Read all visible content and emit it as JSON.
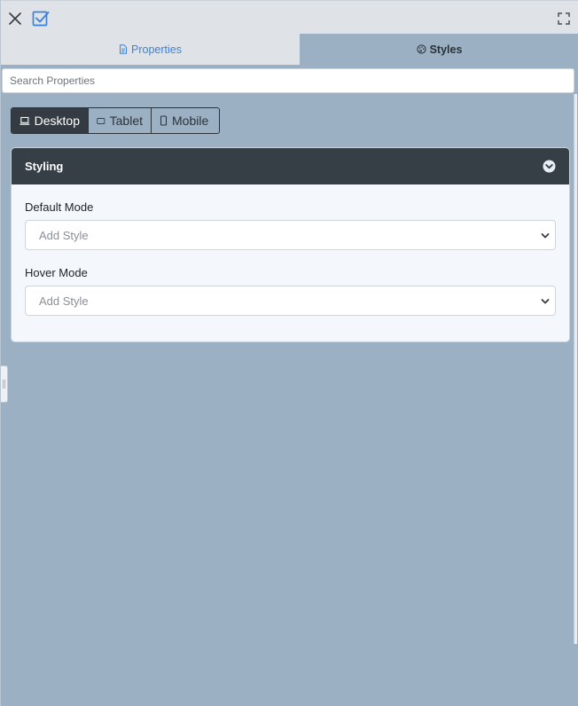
{
  "toolbar": {
    "close_icon": "close-icon",
    "confirm_icon": "checkbox-check-icon",
    "fullscreen_icon": "fullscreen-icon"
  },
  "tabs": [
    {
      "label": "Properties",
      "icon": "document-icon",
      "active": false
    },
    {
      "label": "Styles",
      "icon": "palette-icon",
      "active": true
    }
  ],
  "search": {
    "placeholder": "Search Properties",
    "value": ""
  },
  "devices": [
    {
      "label": "Desktop",
      "icon": "laptop-icon",
      "active": true
    },
    {
      "label": "Tablet",
      "icon": "tablet-icon",
      "active": false
    },
    {
      "label": "Mobile",
      "icon": "mobile-icon",
      "active": false
    }
  ],
  "styling": {
    "title": "Styling",
    "fields": [
      {
        "label": "Default Mode",
        "value": "Add Style"
      },
      {
        "label": "Hover Mode",
        "value": "Add Style"
      }
    ]
  },
  "colors": {
    "panel_bg": "#9bb0c2",
    "toolbar_bg": "#dfe3e8",
    "accent": "#3b82d6",
    "card_header": "#363e46",
    "active_device": "#343b42"
  }
}
